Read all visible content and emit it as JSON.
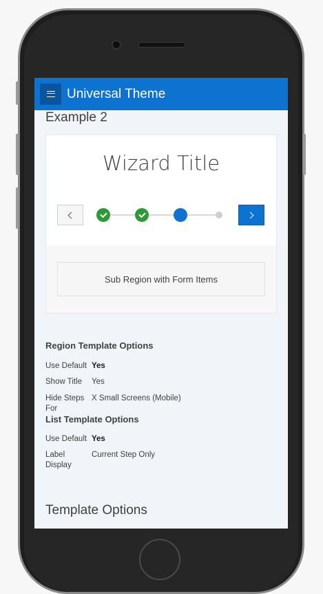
{
  "app": {
    "title": "Universal Theme",
    "menu_icon": "hamburger-icon"
  },
  "example": {
    "title": "Example 2"
  },
  "wizard": {
    "title": "Wizard Title",
    "steps": [
      {
        "state": "complete"
      },
      {
        "state": "complete"
      },
      {
        "state": "current"
      },
      {
        "state": "upcoming"
      }
    ],
    "sub_region": "Sub Region with Form Items",
    "colors": {
      "accent": "#0e72d0",
      "complete": "#2d9b35",
      "upcoming": "#cfcfcf"
    }
  },
  "region_template_options": {
    "heading": "Region Template Options",
    "rows": [
      {
        "key": "Use Default",
        "value": "Yes"
      },
      {
        "key": "Show Title",
        "value": "Yes"
      },
      {
        "key": "Hide Steps For",
        "value": "X Small Screens (Mobile)"
      }
    ]
  },
  "list_template_options": {
    "heading": "List Template Options",
    "rows": [
      {
        "key": "Use Default",
        "value": "Yes"
      },
      {
        "key": "Label Display",
        "value": "Current Step Only"
      }
    ]
  },
  "template_options": {
    "title": "Template Options"
  }
}
